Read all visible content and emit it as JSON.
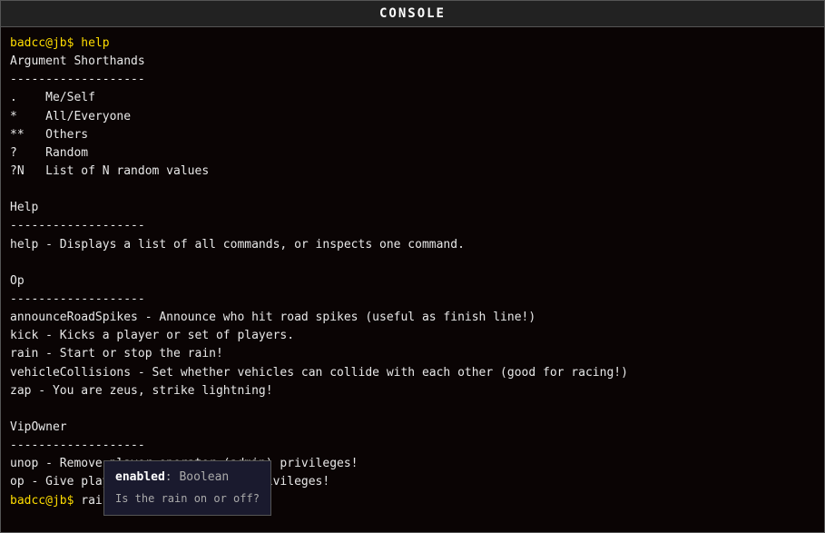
{
  "console": {
    "title": "CONSOLE",
    "content": {
      "prompt_help": "badcc@jb$ help",
      "section_argument_shorthands": "Argument Shorthands",
      "divider1": "-------------------",
      "shorthand_self": ".    Me/Self",
      "shorthand_all": "*    All/Everyone",
      "shorthand_others": "**   Others",
      "shorthand_random": "?    Random",
      "shorthand_n": "?N   List of N random values",
      "section_help": "Help",
      "divider2": "-------------------",
      "help_desc": "help - Displays a list of all commands, or inspects one command.",
      "section_op": "Op",
      "divider3": "-------------------",
      "op_cmd1": "announceRoadSpikes - Announce who hit road spikes (useful as finish line!)",
      "op_cmd2": "kick - Kicks a player or set of players.",
      "op_cmd3": "rain - Start or stop the rain!",
      "op_cmd4": "vehicleCollisions - Set whether vehicles can collide with each other (good for racing!)",
      "op_cmd5": "zap - You are zeus, strike lightning!",
      "section_vipowner": "VipOwner",
      "divider4": "-------------------",
      "vipowner_cmd1": "unop - Remove player operator (admin) privileges!",
      "vipowner_cmd2": "op - Give player operator (admin) privileges!",
      "prompt_rain": "badcc@jb$ rain on"
    },
    "autocomplete": {
      "param_name": "enabled",
      "param_type": ": Boolean",
      "param_desc": "Is the rain on or off?"
    }
  }
}
